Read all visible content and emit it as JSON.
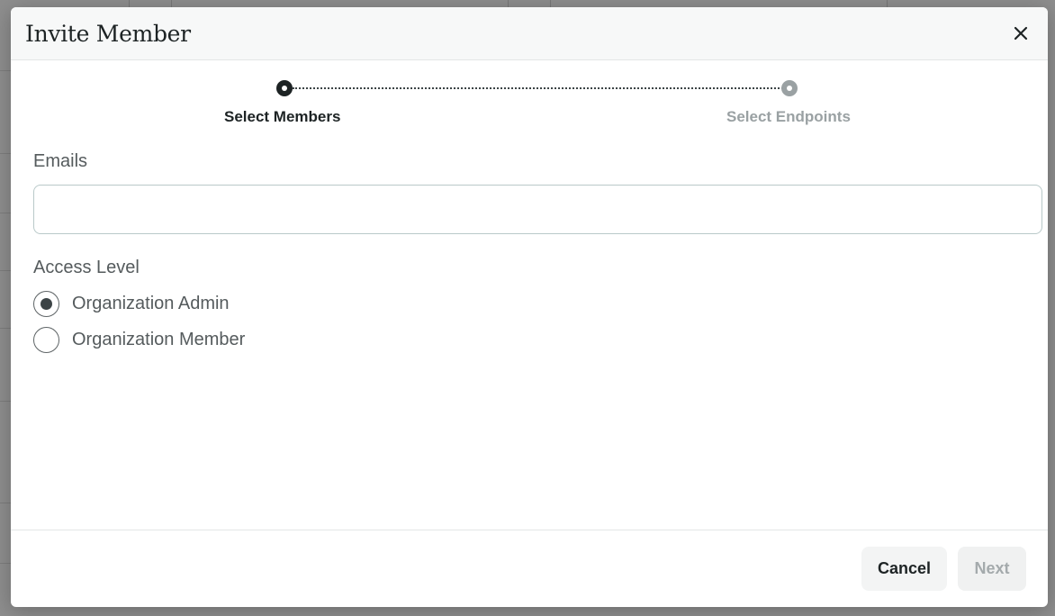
{
  "modal": {
    "title": "Invite Member",
    "close_icon": "close-icon"
  },
  "stepper": {
    "steps": [
      {
        "label": "Select Members",
        "state": "active"
      },
      {
        "label": "Select Endpoints",
        "state": "inactive"
      }
    ]
  },
  "form": {
    "emails_label": "Emails",
    "emails_value": "",
    "emails_placeholder": "",
    "access_level_label": "Access Level",
    "access_options": [
      {
        "label": "Organization Admin",
        "selected": true
      },
      {
        "label": "Organization Member",
        "selected": false
      }
    ]
  },
  "footer": {
    "cancel_label": "Cancel",
    "next_label": "Next",
    "next_disabled": true
  },
  "colors": {
    "primary_text": "#1d2324",
    "muted_text": "#9aa1a3",
    "input_border": "#b9c9c9",
    "overlay": "rgba(0,0,0,0.42)"
  }
}
